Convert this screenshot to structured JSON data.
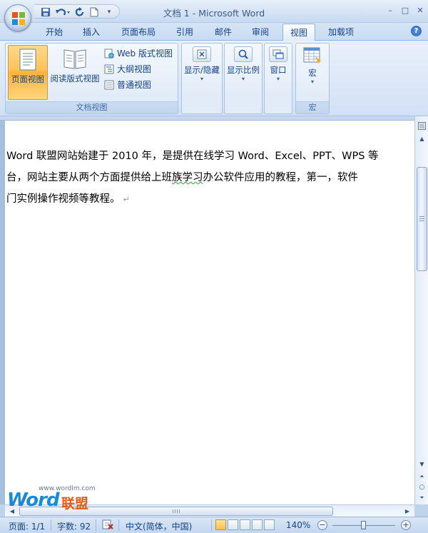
{
  "window": {
    "title": "文档 1 - Microsoft Word",
    "minimize": "–",
    "maximize": "□",
    "close": "✕"
  },
  "tabs": [
    {
      "label": "开始",
      "active": false
    },
    {
      "label": "插入",
      "active": false
    },
    {
      "label": "页面布局",
      "active": false
    },
    {
      "label": "引用",
      "active": false
    },
    {
      "label": "邮件",
      "active": false
    },
    {
      "label": "审阅",
      "active": false
    },
    {
      "label": "视图",
      "active": true
    },
    {
      "label": "加载项",
      "active": false
    }
  ],
  "help_label": "?",
  "ribbon": {
    "doc_views": {
      "group_label": "文档视图",
      "print_layout": "页面视图",
      "full_screen_reading": "阅读版式视图",
      "web_layout": "Web 版式视图",
      "outline": "大纲视图",
      "draft": "普通视图"
    },
    "show_hide": {
      "label": "显示/隐藏"
    },
    "zoom": {
      "label": "显示比例"
    },
    "window": {
      "label": "窗口"
    },
    "macros": {
      "label": "宏",
      "group_label": "宏"
    }
  },
  "document": {
    "line1": "Word 联盟网站始建于 2010 年，是提供在线学习 Word、Excel、PPT、WPS 等",
    "line2_before": "台，网站主要从两个方面提供给上班",
    "line2_underlined": "族学习",
    "line2_after": "办公软件应用的教程，第一，软件",
    "line3": "门实例操作视频等教程。",
    "para_mark": "↵"
  },
  "watermark": {
    "url": "www.wordlm.com",
    "word": "Word",
    "cn": "联盟"
  },
  "status": {
    "page": "页面: 1/1",
    "words": "字数: 92",
    "language": "中文(简体，中国)",
    "zoom": "140%",
    "zoom_minus": "−",
    "zoom_plus": "+"
  },
  "colors": {
    "accent": "#15428b",
    "ribbon_active": "#ffc25a",
    "watermark_blue": "#1a8ad6",
    "watermark_orange": "#e65c0d"
  }
}
